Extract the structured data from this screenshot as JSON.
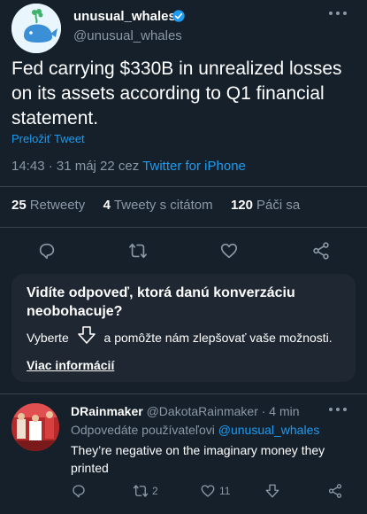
{
  "tweet": {
    "display_name": "unusual_whales",
    "handle": "@unusual_whales",
    "text": "Fed carrying $330B in unrealized losses on its assets according to Q1 financial statement.",
    "translate_label": "Preložiť Tweet",
    "time": "14:43 · 31 máj 22 cez",
    "source": "Twitter for iPhone",
    "retweets": {
      "count": "25",
      "label": "Retweety"
    },
    "quotes": {
      "count": "4",
      "label": "Tweety s citátom"
    },
    "likes": {
      "count": "120",
      "label": "Páči sa"
    }
  },
  "prompt": {
    "title": "Vidíte odpoveď, ktorá danú konverzáciu neobohacuje?",
    "body_before": "Vyberte",
    "body_after": "a pomôžte nám zlepšovať vaše možnosti.",
    "more_info": "Viac informácií"
  },
  "reply": {
    "display_name": "DRainmaker",
    "handle": "@DakotaRainmaker",
    "time": "· 4 min",
    "replying_to_label": "Odpovedáte používateľovi",
    "replying_to_handle": "@unusual_whales",
    "text": "They’re negative on the imaginary money they printed",
    "retweet_count": "2",
    "like_count": "11"
  },
  "colors": {
    "background": "#15202b",
    "accent": "#1d9bf0",
    "secondary_text": "#8b98a5",
    "divider": "#38444d",
    "prompt_bg": "#1e2732"
  },
  "icons": [
    "verified-badge-icon",
    "more-icon",
    "reply-icon",
    "retweet-icon",
    "like-icon",
    "share-icon",
    "arrow-down-icon",
    "downvote-icon"
  ]
}
